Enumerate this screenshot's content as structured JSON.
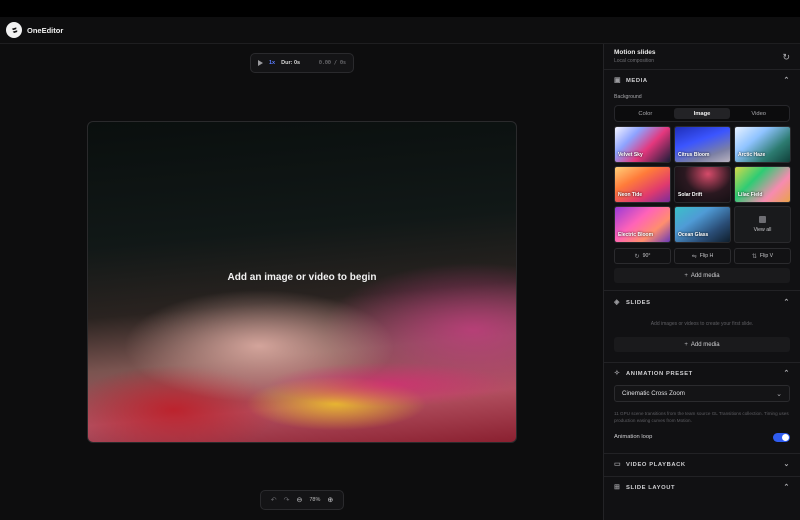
{
  "app": {
    "name": "OneEditor"
  },
  "playback": {
    "speed": "1x",
    "duration": "Dur: 0s",
    "time": "0.00 / 0s"
  },
  "preview": {
    "placeholder": "Add an image or video to begin"
  },
  "zoom": {
    "level": "78%"
  },
  "panel": {
    "title": "Motion slides",
    "subtitle": "Local composition",
    "media": {
      "heading": "MEDIA",
      "background_label": "Background",
      "tabs": [
        {
          "label": "Color",
          "active": false
        },
        {
          "label": "Image",
          "active": true
        },
        {
          "label": "Video",
          "active": false
        }
      ],
      "presets": [
        {
          "label": "Velvet Sky"
        },
        {
          "label": "Citrus Bloom"
        },
        {
          "label": "Arctic Haze"
        },
        {
          "label": "Neon Tide"
        },
        {
          "label": "Solar Drift"
        },
        {
          "label": "Lilac Field"
        },
        {
          "label": "Electric Bloom"
        },
        {
          "label": "Ocean Glass"
        }
      ],
      "view_all": "View all",
      "tools": {
        "rotate": "90°",
        "flip_h": "Flip H",
        "flip_v": "Flip V"
      },
      "add_media": "Add media"
    },
    "slides": {
      "heading": "SLIDES",
      "empty_hint": "Add images or videos to create your first slide.",
      "add_media": "Add media"
    },
    "animation_preset": {
      "heading": "ANIMATION PRESET",
      "selected": "Cinematic Cross Zoom",
      "description": "11 GPU scene transitions from the team source GL Transitions collection. Timing uses production easing curves from Motion.",
      "loop_label": "Animation loop",
      "loop_on": true
    },
    "video_playback": {
      "heading": "VIDEO PLAYBACK"
    },
    "slide_layout": {
      "heading": "SLIDE LAYOUT"
    }
  },
  "colors": {
    "accent": "#2f5cf0",
    "speed": "#5b7cff"
  }
}
